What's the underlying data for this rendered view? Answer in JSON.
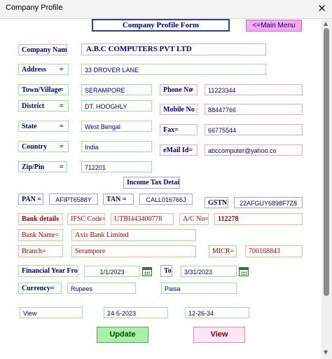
{
  "window": {
    "title": "Company Profile",
    "close_glyph": "✕"
  },
  "form": {
    "title": "Company Profile Form",
    "main_menu": "<=Main Menu"
  },
  "company": {
    "name_label": "Company Name=",
    "name": "A.B.C COMPUTERS PVT LTD",
    "address_label": "Address",
    "address_eq": "=",
    "address": "33 DROVER LANE",
    "town_label": "Town/Village",
    "town_eq": "=",
    "town": "SERAMPORE",
    "district_label": "District",
    "district_eq": "=",
    "district": "DT. HOOGHLY",
    "state_label": "State",
    "state_eq": "=",
    "state": "West Bengal",
    "country_label": "Country",
    "country_eq": "=",
    "country": "India",
    "zip_label": "Zip/Pin",
    "zip_eq": "=",
    "zip": "712201",
    "phone_label": "Phone No",
    "phone_eq": "=",
    "phone": "11223344",
    "mobile_label": "Mobile No =",
    "mobile": "88447766",
    "fax_label": "Fax",
    "fax_eq": "=",
    "fax": "66775544",
    "email_label": "eMail Id=",
    "email": "abccomputer@yahoo.co"
  },
  "tax": {
    "section_label": "Income Tax Details",
    "pan_label": "PAN =",
    "pan": "AFIPT6588Y",
    "tan_label": "TAN =",
    "tan": "CALL016766J",
    "gstn_label": "GSTN =",
    "gstn": "22AFGUY6898F7Z8"
  },
  "bank": {
    "details_label": "Bank details",
    "ifsc_label": "IFSC Code=",
    "ifsc": "UTBI443400778",
    "ac_label": "A/C No=",
    "ac": "112278",
    "name_label": "Bank Name=",
    "name": "Axis Bank Limited",
    "branch_label": "Branch=",
    "branch": "Serampore",
    "micr_label": "MICR=",
    "micr": "700168843"
  },
  "financial": {
    "from_label": "Financial Year From =",
    "from": "1/1/2023",
    "to_label": "To",
    "to": "3/31/2023",
    "currency_label": "Currency=",
    "currency": "Rupees",
    "sub_currency": "Paisa"
  },
  "footer": {
    "view_text": "View",
    "date": "24-5-2023",
    "time": "12-26-34"
  },
  "buttons": {
    "update": "Update",
    "view": "View"
  },
  "scrollbar": {
    "up": "▲",
    "down": "▼"
  },
  "icons": {
    "calendar": "calendar-icon"
  }
}
